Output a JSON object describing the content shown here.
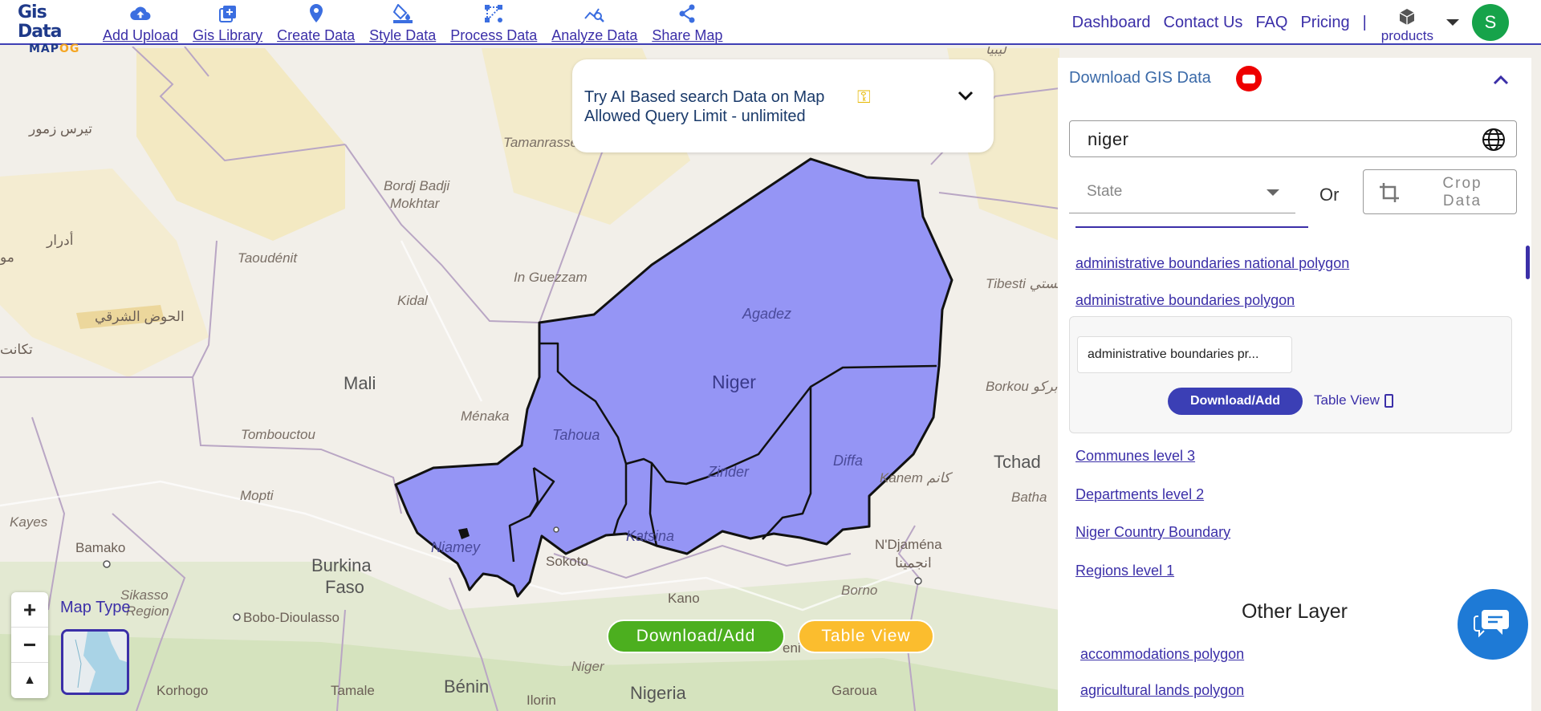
{
  "brand": {
    "line1": "Gis Data",
    "line2a": "MAP",
    "line2b": "OG"
  },
  "nav": [
    {
      "label": "Add Upload",
      "icon": "cloud-upload-icon"
    },
    {
      "label": "Gis Library",
      "icon": "library-add-icon"
    },
    {
      "label": "Create Data",
      "icon": "location-pin-icon"
    },
    {
      "label": "Style Data",
      "icon": "paint-bucket-icon"
    },
    {
      "label": "Process Data",
      "icon": "process-nodes-icon"
    },
    {
      "label": "Analyze Data",
      "icon": "analyze-chart-icon"
    },
    {
      "label": "Share Map",
      "icon": "share-icon"
    }
  ],
  "right_nav": {
    "dashboard": "Dashboard",
    "contact": "Contact Us",
    "faq": "FAQ",
    "pricing": "Pricing",
    "separator": "|",
    "products": "products",
    "avatar_letter": "S"
  },
  "ai_search": {
    "line1": "Try AI Based search Data on Map",
    "line2": "Allowed Query Limit - unlimited"
  },
  "map": {
    "labels": {
      "niger": "Niger",
      "agadez": "Agadez",
      "tahoua": "Tahoua",
      "zinder": "Zinder",
      "diffa": "Diffa",
      "niamey": "Niamey",
      "katsina": "Katsina",
      "mali": "Mali",
      "tchad": "Tchad",
      "burkina": "Burkina",
      "faso": "Faso",
      "nigeria": "Nigeria",
      "benin": "Bénin",
      "tamanrasset": "Tamanrasset",
      "bordj1": "Bordj Badji",
      "bordj2": "Mokhtar",
      "taoudenit": "Taoudénit",
      "in_guezzam": "In Guezzam",
      "kidal": "Kidal",
      "menaka": "Ménaka",
      "tombouctou": "Tombouctou",
      "mopti": "Mopti",
      "kayes": "Kayes",
      "bamako": "Bamako",
      "sikasso": "Sikasso",
      "region": "Region",
      "bobo": "Bobo-Dioulasso",
      "korhogo": "Korhogo",
      "tamale": "Tamale",
      "ilorin": "Ilorin",
      "sokoto": "Sokoto",
      "kano": "Kano",
      "niger_river": "Niger",
      "borno": "Borno",
      "garoua": "Garoua",
      "ndjamena": "N'Djaména",
      "ndjamena_ar": "انجمينا",
      "kanem": "Kanem كانم",
      "batha": "Batha",
      "borkou": "Borkou بركو",
      "tibesti": "Tibesti تيبستي",
      "tiris": "تيرس زمور",
      "adrar": "أدرار",
      "hodh": "الحوض الشرقي",
      "takant": "تكانت",
      "mo": "مو",
      "libya": "ليبيا",
      "eni": "eni"
    },
    "zoom_in": "+",
    "zoom_out": "−",
    "reset": "▲",
    "map_type_label": "Map Type",
    "download_button": "Download/Add",
    "table_view_button": "Table View"
  },
  "panel": {
    "title": "Download GIS Data",
    "search_value": "niger",
    "state_placeholder": "State",
    "or_label": "Or",
    "crop_label": "Crop Data",
    "links_top": [
      "administrative boundaries national polygon",
      "administrative boundaries polygon"
    ],
    "card": {
      "chip": "administrative boundaries pr...",
      "download": "Download/Add",
      "table_view": "Table View"
    },
    "links_bottom": [
      "Communes level 3",
      "Departments level 2",
      "Niger Country Boundary",
      "Regions level 1"
    ],
    "other_layer_title": "Other Layer",
    "other_links": [
      "accommodations polygon",
      "agricultural lands polygon"
    ]
  },
  "colors": {
    "accent": "#3b2fa8",
    "niger_fill": "#8f8ff5",
    "download_green": "#4caf1f",
    "table_yellow": "#fbbd2e"
  }
}
